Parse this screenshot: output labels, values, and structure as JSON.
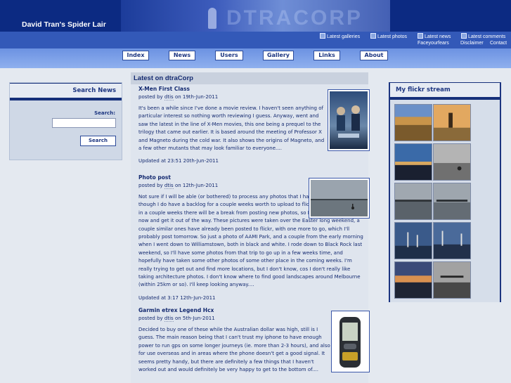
{
  "site": {
    "title": "David Tran's Spider Lair",
    "banner_text": "DTRACORP"
  },
  "feeds": [
    {
      "label": "Latest galleries",
      "icon": "rss-icon"
    },
    {
      "label": "Latest photos",
      "icon": "rss-icon"
    },
    {
      "label": "Latest news",
      "icon": "rss-icon"
    },
    {
      "label": "Latest comments",
      "icon": "rss-icon"
    }
  ],
  "utility_links": [
    "Faceyourfears",
    "Disclaimer",
    "Contact"
  ],
  "nav": [
    "Index",
    "News",
    "Users",
    "Gallery",
    "Links",
    "About"
  ],
  "search": {
    "heading": "Search News",
    "label": "Search:",
    "value": "",
    "button": "Search"
  },
  "main": {
    "heading": "Latest on dtraCorp",
    "posts": [
      {
        "title": "X-Men First Class",
        "posted_prefix": "posted by",
        "author": "dtis",
        "date": "on 19th-Jun-2011",
        "body": "It's been a while since I've done a movie review. I haven't seen anything of particular interest so nothing worth reviewing I guess. Anyway, went and saw the latest in the line of X-Men movies, this one being a prequel to the trilogy that came out earlier. It is based around the meeting of Professor X and Magneto during the cold war. It also shows the origins of Magneto, and a few other mutants that may look familiar to everyone....",
        "updated": "Updated at 23:51 20th-Jun-2011"
      },
      {
        "title": "Photo post",
        "posted_prefix": "posted by",
        "author": "dtis",
        "date": "on 12th-Jun-2011",
        "body": "Not sure if I will be able (or bothered) to process any photos that I have taken recently, though I do have a backlog for a couple weeks worth to upload to flickr at the moment. So in a couple weeks there will be a break from posting new photos, so I thought I'd post this now and get it out of the way. These pictures were taken over the Easter long weekend, a couple similar ones have already been posted to flickr, with one more to go, which I'll probably post tomorrow. So just a photo of AAMI Park, and a couple from the early morning when I went down to Williamstown, both in black and white. I rode down to Black Rock last weekend, so I'll have some photos from that trip to go up in a few weeks time, and hopefully have taken some other photos of some other place in the coming weeks. I'm really trying to get out and find more locations, but I don't know, cos I don't really like taking architecture photos. I don't know where to find good landscapes around Melbourne (within 25km or so). I'll keep looking anyway....",
        "updated": "Updated at 3:17 12th-Jun-2011"
      },
      {
        "title": "Garmin etrex Legend Hcx",
        "posted_prefix": "posted by",
        "author": "dtis",
        "date": "on 5th-Jun-2011",
        "body": "Decided to buy one of these while the Australian dollar was high, still is I guess. The main reason being that I can't trust my iphone to have enough power to run gps on some longer journeys (ie. more than 2-3 hours), and also for use overseas and in areas where the phone doesn't get a good signal. It seems pretty handy, but there are definitely a few things that I haven't worked out and would definitely be very happy to get to the bottom of...."
      }
    ]
  },
  "flickr": {
    "heading": "My flickr stream"
  },
  "colors": {
    "header_bg": "#0c2a82",
    "link_bar": "#3359b8",
    "nav_bar": "#7ea0e8",
    "text": "#142a70"
  }
}
